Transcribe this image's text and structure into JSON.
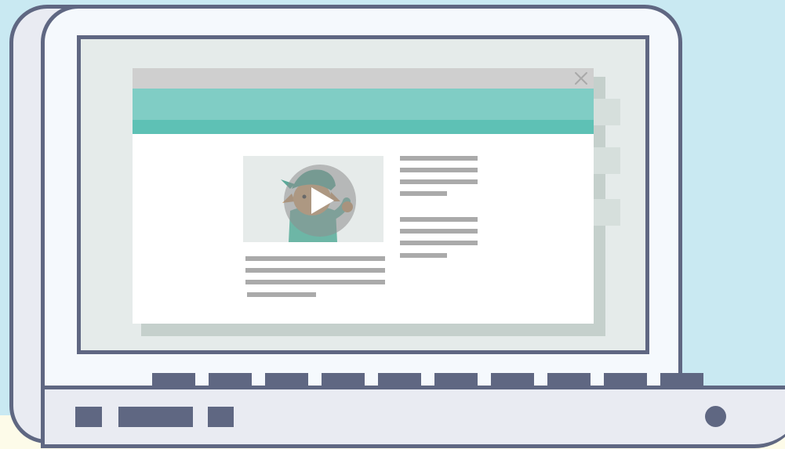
{
  "scene": {
    "colors": {
      "sky": "#c9e9f2",
      "floor": "#fdfbe9",
      "outline": "#5f6782",
      "laptop_body": "#e9ebf2",
      "screen": "#e5ebea",
      "popup_header": "#cfcfcf",
      "banner_light": "#80cdc5",
      "banner_dark": "#5ec1b5",
      "text_placeholder": "#aaaaaa"
    },
    "popup": {
      "close_icon": "close-icon",
      "video_icon": "play-icon",
      "video_character": "elf-character"
    }
  }
}
